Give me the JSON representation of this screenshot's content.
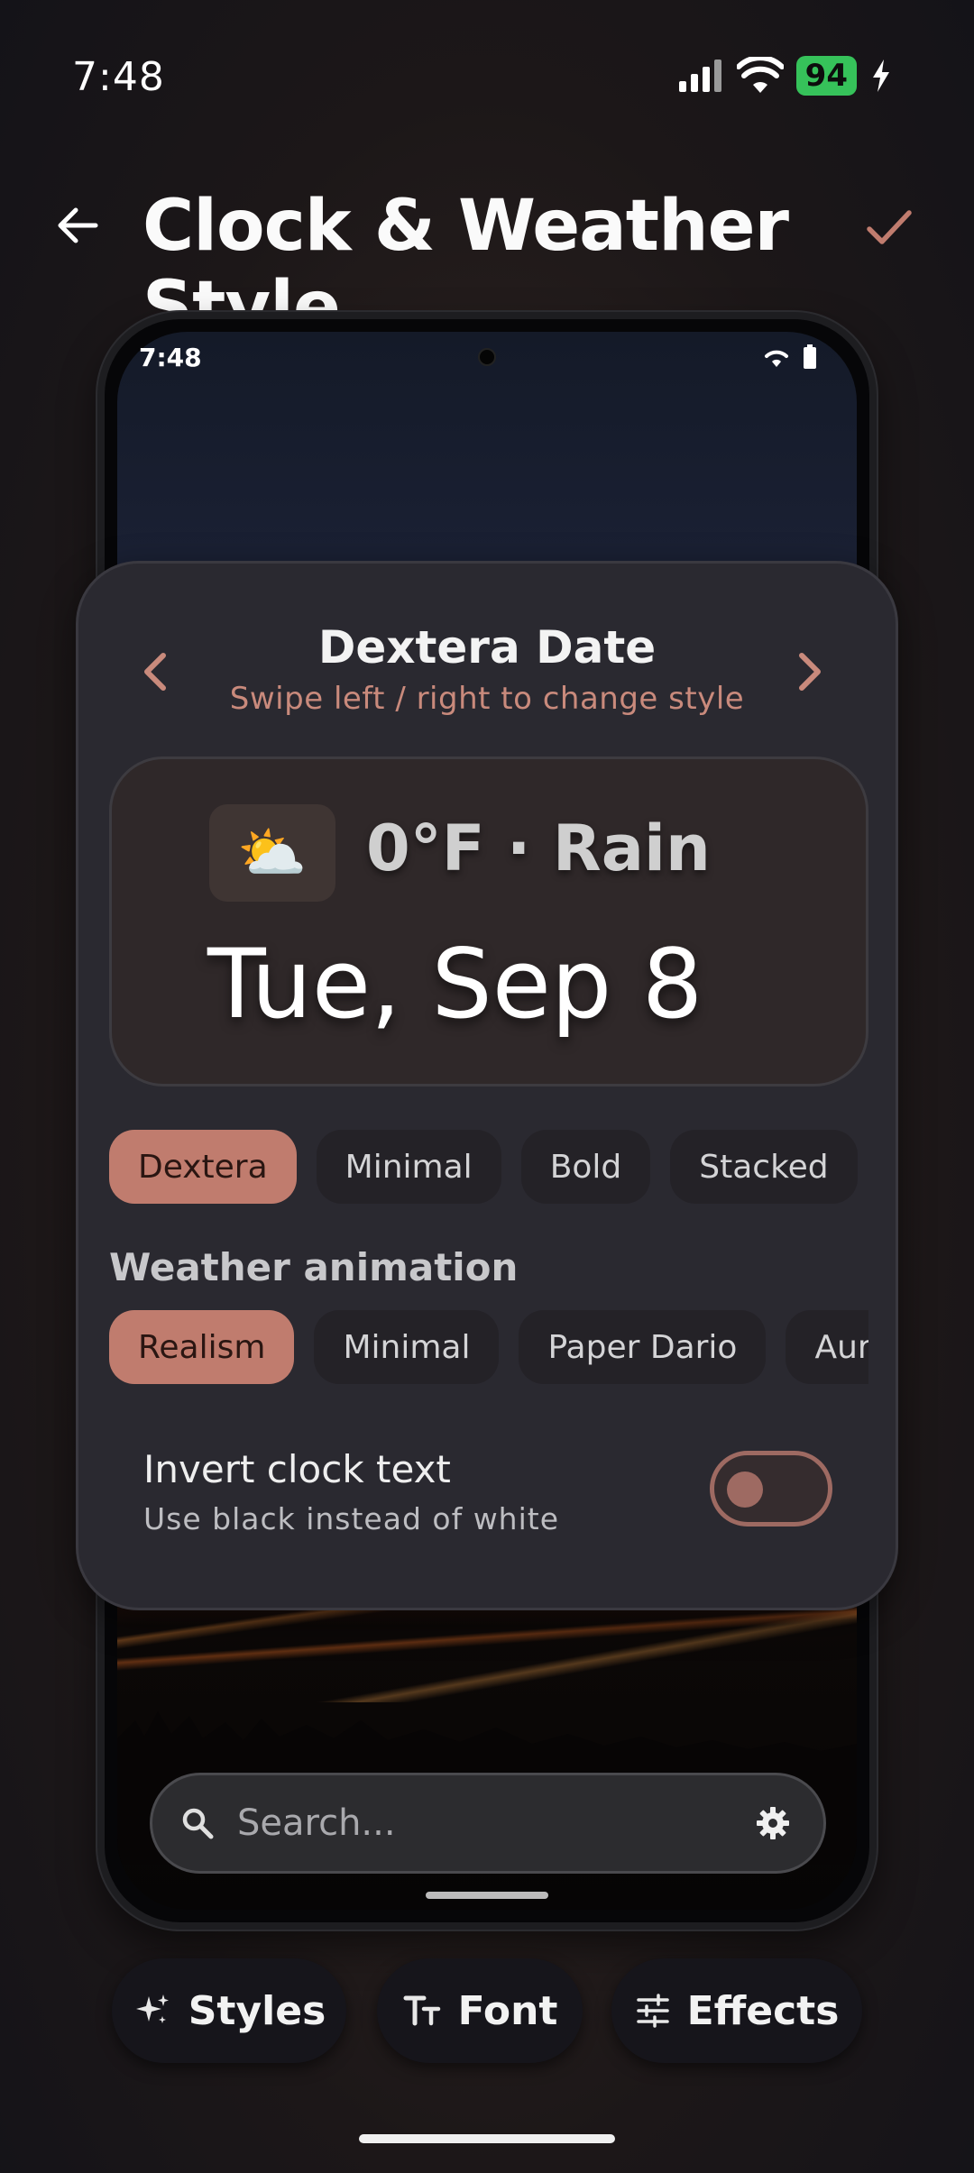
{
  "status_bar": {
    "time": "7:48",
    "battery": "94"
  },
  "header": {
    "title": "Clock & Weather Style"
  },
  "preview_phone": {
    "time": "7:48"
  },
  "panel": {
    "style_name": "Dextera Date",
    "hint": "Swipe left / right to change style",
    "preview": {
      "weather_emoji": "⛅",
      "weather": "0°F · Rain",
      "date": "Tue, Sep 8"
    },
    "style_chips": [
      "Dextera",
      "Minimal",
      "Bold",
      "Stacked"
    ],
    "selected_style": "Dextera",
    "animation_label": "Weather animation",
    "animation_chips": [
      "Realism",
      "Minimal",
      "Paper Dario",
      "Aurc"
    ],
    "selected_animation": "Realism",
    "invert": {
      "title": "Invert clock text",
      "subtitle": "Use black instead of white",
      "enabled": false
    }
  },
  "search": {
    "placeholder": "Search..."
  },
  "tabs": {
    "styles": "Styles",
    "font": "Font",
    "effects": "Effects"
  },
  "colors": {
    "accent": "#c07c6e",
    "panel_bg": "#2a2930",
    "battery": "#36c25a"
  }
}
